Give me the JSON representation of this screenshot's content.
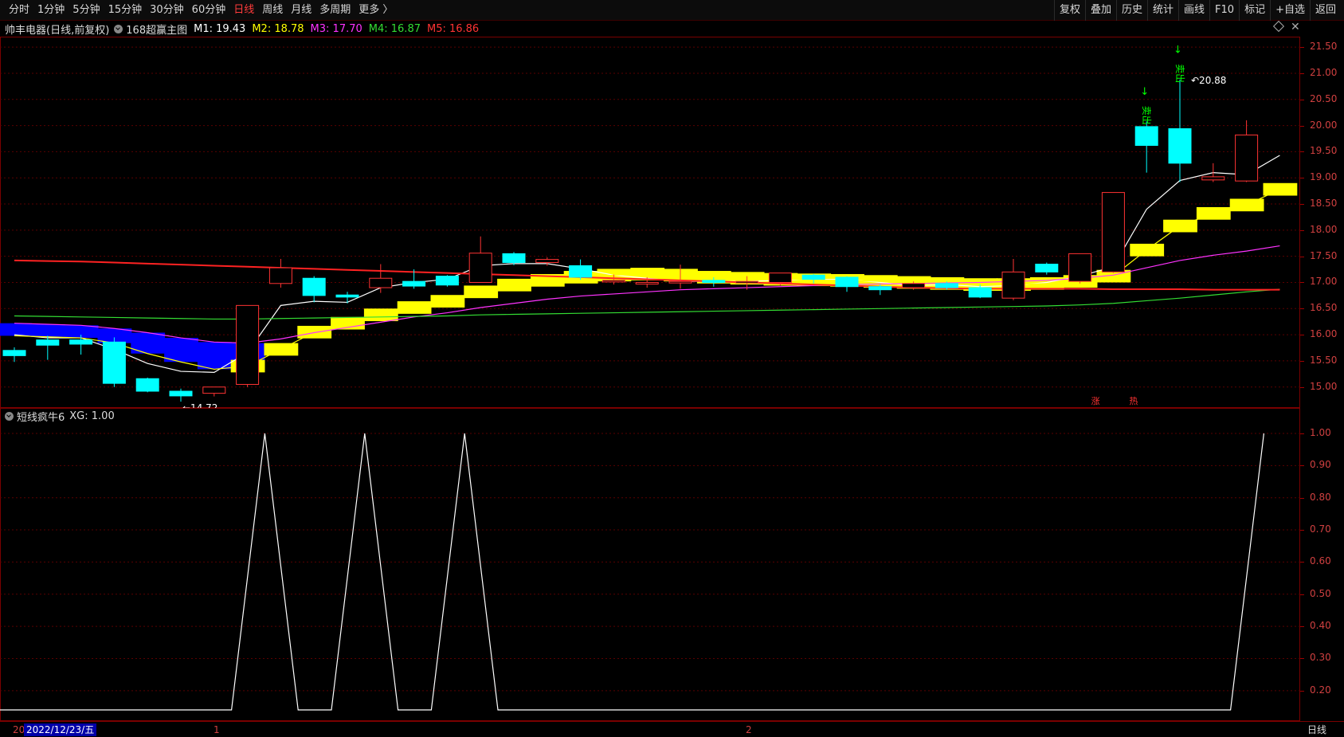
{
  "toolbar": {
    "periods": [
      "分时",
      "1分钟",
      "5分钟",
      "15分钟",
      "30分钟",
      "60分钟",
      "日线",
      "周线",
      "月线",
      "多周期",
      "更多 〉"
    ],
    "active_period": "日线",
    "right_buttons": [
      "复权",
      "叠加",
      "历史",
      "统计",
      "画线",
      "F10",
      "标记",
      "+自选",
      "返回"
    ]
  },
  "main_chart": {
    "stock_name": "帅丰电器(日线,前复权)",
    "indicator_name": "168超赢主图",
    "ma": [
      {
        "label": "M1: 19.43",
        "color": "#ffffff"
      },
      {
        "label": "M2: 18.78",
        "color": "#ffff00"
      },
      {
        "label": "M3: 17.70",
        "color": "#ff33ff"
      },
      {
        "label": "M4: 16.87",
        "color": "#33dd33"
      },
      {
        "label": "M5: 16.86",
        "color": "#ff3333"
      }
    ],
    "price_axis": [
      "21.50",
      "21.00",
      "20.50",
      "20.00",
      "19.50",
      "19.00",
      "18.50",
      "18.00",
      "17.50",
      "17.00",
      "16.50",
      "16.00",
      "15.50",
      "15.00"
    ],
    "high_label": "20.88",
    "low_label": "14.72",
    "sell_signals": [
      "卖出",
      "卖出"
    ],
    "bottom_markers": [
      "涨",
      "热"
    ]
  },
  "sub_chart": {
    "indicator_name": "短线疯牛6",
    "value_label": "XG: 1.00",
    "axis": [
      "1.00",
      "0.90",
      "0.80",
      "0.70",
      "0.60",
      "0.50",
      "0.40",
      "0.30",
      "0.20"
    ]
  },
  "bottom": {
    "left_fragment": "20",
    "cursor_date": "2022/12/23/五",
    "month_marks": [
      "1",
      "2"
    ],
    "period_label": "日线"
  },
  "chart_data": {
    "type": "candlestick",
    "price_range": [
      14.6,
      21.7
    ],
    "candles": [
      {
        "o": 15.7,
        "c": 15.6,
        "h": 15.76,
        "l": 15.48
      },
      {
        "o": 15.9,
        "c": 15.8,
        "h": 15.98,
        "l": 15.52
      },
      {
        "o": 15.9,
        "c": 15.82,
        "h": 16.0,
        "l": 15.62
      },
      {
        "o": 15.86,
        "c": 15.07,
        "h": 15.95,
        "l": 15.0
      },
      {
        "o": 15.16,
        "c": 14.92,
        "h": 15.18,
        "l": 14.9
      },
      {
        "o": 14.92,
        "c": 14.83,
        "h": 14.97,
        "l": 14.72
      },
      {
        "o": 14.88,
        "c": 15.0,
        "h": 15.0,
        "l": 14.82
      },
      {
        "o": 15.05,
        "c": 16.56,
        "h": 16.56,
        "l": 15.0
      },
      {
        "o": 16.98,
        "c": 17.28,
        "h": 17.45,
        "l": 16.9
      },
      {
        "o": 17.08,
        "c": 16.75,
        "h": 17.12,
        "l": 16.62
      },
      {
        "o": 16.76,
        "c": 16.72,
        "h": 16.82,
        "l": 16.6
      },
      {
        "o": 16.9,
        "c": 17.08,
        "h": 17.35,
        "l": 16.8
      },
      {
        "o": 17.02,
        "c": 16.93,
        "h": 17.25,
        "l": 16.88
      },
      {
        "o": 17.12,
        "c": 16.95,
        "h": 17.14,
        "l": 16.92
      },
      {
        "o": 17.0,
        "c": 17.56,
        "h": 17.88,
        "l": 17.0
      },
      {
        "o": 17.55,
        "c": 17.38,
        "h": 17.58,
        "l": 17.33
      },
      {
        "o": 17.38,
        "c": 17.44,
        "h": 17.48,
        "l": 17.32
      },
      {
        "o": 17.32,
        "c": 17.1,
        "h": 17.44,
        "l": 17.05
      },
      {
        "o": 17.04,
        "c": 17.04,
        "h": 17.15,
        "l": 16.96
      },
      {
        "o": 17.0,
        "c": 17.0,
        "h": 17.1,
        "l": 16.9
      },
      {
        "o": 17.0,
        "c": 17.02,
        "h": 17.34,
        "l": 16.88
      },
      {
        "o": 17.04,
        "c": 17.0,
        "h": 17.1,
        "l": 16.92
      },
      {
        "o": 17.0,
        "c": 17.02,
        "h": 17.12,
        "l": 16.86
      },
      {
        "o": 17.0,
        "c": 17.18,
        "h": 17.18,
        "l": 16.94
      },
      {
        "o": 17.14,
        "c": 17.06,
        "h": 17.16,
        "l": 16.98
      },
      {
        "o": 17.1,
        "c": 16.92,
        "h": 17.12,
        "l": 16.82
      },
      {
        "o": 16.92,
        "c": 16.86,
        "h": 16.96,
        "l": 16.76
      },
      {
        "o": 16.9,
        "c": 16.98,
        "h": 17.02,
        "l": 16.86
      },
      {
        "o": 16.98,
        "c": 16.9,
        "h": 17.02,
        "l": 16.86
      },
      {
        "o": 16.9,
        "c": 16.72,
        "h": 16.96,
        "l": 16.7
      },
      {
        "o": 16.7,
        "c": 17.2,
        "h": 17.45,
        "l": 16.66
      },
      {
        "o": 17.35,
        "c": 17.2,
        "h": 17.38,
        "l": 17.15
      },
      {
        "o": 17.02,
        "c": 17.55,
        "h": 17.55,
        "l": 16.98
      },
      {
        "o": 17.2,
        "c": 18.72,
        "h": 18.72,
        "l": 17.18
      },
      {
        "o": 19.98,
        "c": 19.62,
        "h": 20.08,
        "l": 19.1
      },
      {
        "o": 19.94,
        "c": 19.28,
        "h": 20.88,
        "l": 18.92
      },
      {
        "o": 18.96,
        "c": 19.02,
        "h": 19.28,
        "l": 18.92
      },
      {
        "o": 18.94,
        "c": 19.82,
        "h": 20.1,
        "l": 18.92
      }
    ],
    "ma_lines": {
      "M1": [
        16.0,
        15.94,
        15.94,
        15.72,
        15.45,
        15.3,
        15.28,
        15.66,
        16.56,
        16.64,
        16.62,
        16.9,
        17.0,
        17.06,
        17.32,
        17.36,
        17.36,
        17.26,
        17.14,
        17.08,
        17.02,
        17.02,
        17.02,
        17.04,
        17.06,
        17.06,
        17.0,
        16.94,
        16.96,
        16.92,
        16.94,
        17.0,
        17.12,
        17.3,
        18.4,
        18.95,
        19.1,
        19.06,
        19.43
      ],
      "M2": [
        15.98,
        15.96,
        15.94,
        15.84,
        15.64,
        15.48,
        15.34,
        15.4,
        15.72,
        16.05,
        16.22,
        16.38,
        16.52,
        16.64,
        16.82,
        16.95,
        17.04,
        17.1,
        17.14,
        17.16,
        17.14,
        17.1,
        17.08,
        17.06,
        17.05,
        17.04,
        17.02,
        17.0,
        16.98,
        16.96,
        16.96,
        16.98,
        17.02,
        17.12,
        17.62,
        18.08,
        18.32,
        18.48,
        18.78
      ],
      "M3": [
        16.22,
        16.2,
        16.18,
        16.12,
        16.04,
        15.94,
        15.86,
        15.84,
        15.92,
        16.04,
        16.14,
        16.24,
        16.34,
        16.42,
        16.52,
        16.6,
        16.68,
        16.74,
        16.78,
        16.82,
        16.86,
        16.88,
        16.9,
        16.92,
        16.94,
        16.96,
        16.97,
        16.98,
        16.99,
        17.0,
        17.02,
        17.04,
        17.08,
        17.14,
        17.28,
        17.42,
        17.52,
        17.6,
        17.7
      ],
      "M4": [
        16.36,
        16.35,
        16.34,
        16.33,
        16.32,
        16.31,
        16.3,
        16.3,
        16.31,
        16.32,
        16.33,
        16.34,
        16.35,
        16.36,
        16.38,
        16.39,
        16.4,
        16.41,
        16.42,
        16.43,
        16.44,
        16.45,
        16.46,
        16.47,
        16.48,
        16.49,
        16.5,
        16.51,
        16.52,
        16.53,
        16.54,
        16.55,
        16.57,
        16.6,
        16.65,
        16.7,
        16.76,
        16.82,
        16.87
      ],
      "M5": [
        17.42,
        17.41,
        17.4,
        17.38,
        17.36,
        17.34,
        17.32,
        17.3,
        17.28,
        17.26,
        17.24,
        17.22,
        17.2,
        17.18,
        17.16,
        17.14,
        17.12,
        17.1,
        17.08,
        17.06,
        17.04,
        17.02,
        17.0,
        16.98,
        16.96,
        16.94,
        16.92,
        16.9,
        16.89,
        16.88,
        16.88,
        16.88,
        16.88,
        16.87,
        16.87,
        16.87,
        16.86,
        16.86,
        16.86
      ]
    },
    "step_band": [
      {
        "from": 0,
        "to": 7,
        "low": 15.48,
        "high": 16.12,
        "color": "blue"
      },
      {
        "from": 7,
        "to": 38,
        "low": 15.48,
        "high": 18.5,
        "color": "yellow"
      }
    ],
    "xg_values": [
      0,
      0,
      0,
      0,
      0,
      0,
      0,
      0,
      1,
      0,
      0,
      1,
      0,
      0,
      1,
      0,
      0,
      0,
      0,
      0,
      0,
      0,
      0,
      0,
      0,
      0,
      0,
      0,
      0,
      0,
      0,
      0,
      0,
      0,
      0,
      0,
      0,
      0,
      1
    ],
    "xg_range": [
      0.15,
      1.0
    ]
  }
}
